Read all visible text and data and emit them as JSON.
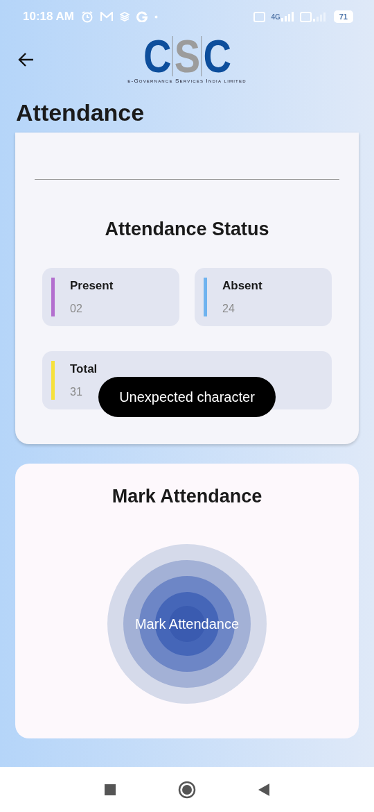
{
  "status_bar": {
    "time": "10:18 AM",
    "network": "4G",
    "battery": "71"
  },
  "app_bar": {
    "logo_letters": [
      "C",
      "S",
      "C"
    ],
    "logo_tagline": "e-Governance Services India limited"
  },
  "title": "Attendance",
  "status_card": {
    "heading": "Attendance Status",
    "stats": [
      {
        "label": "Present",
        "value": "02",
        "color": "#b36fcf"
      },
      {
        "label": "Absent",
        "value": "24",
        "color": "#6fb3ef"
      },
      {
        "label": "Total",
        "value": "31",
        "color": "#f6e13c"
      }
    ]
  },
  "mark_card": {
    "heading": "Mark Attendance",
    "button": "Mark Attendance"
  },
  "toast": {
    "message": "Unexpected character"
  }
}
